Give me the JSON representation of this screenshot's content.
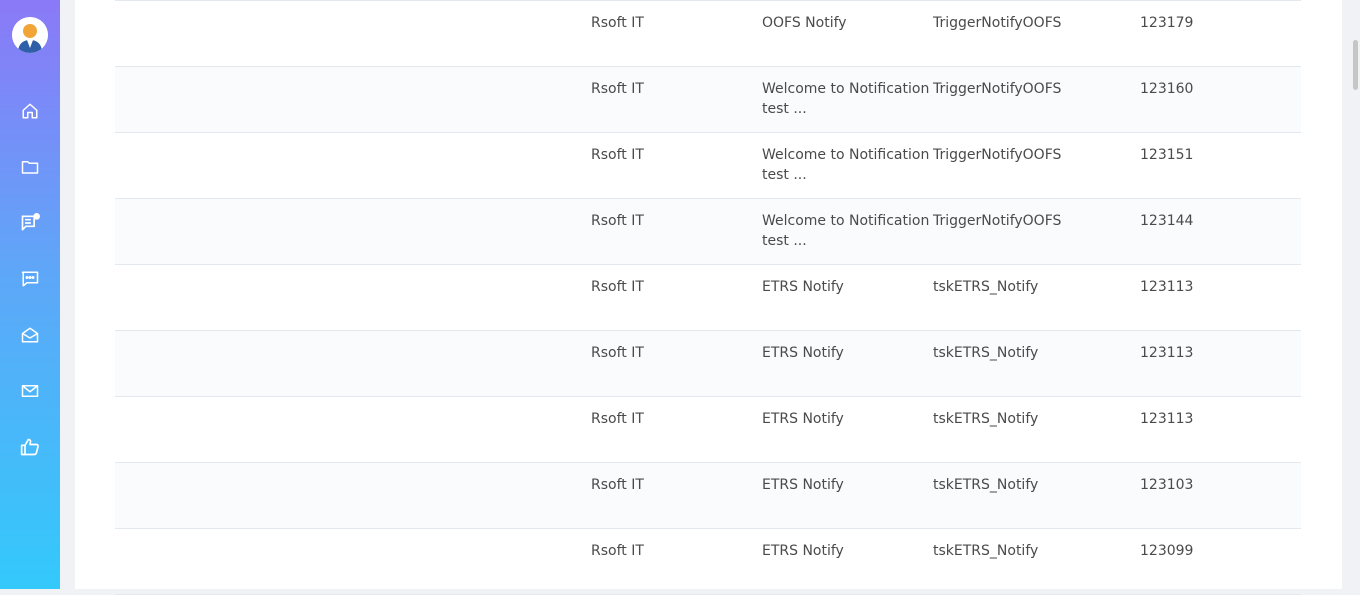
{
  "sidebar": {
    "gradient_top": "#8b79f7",
    "gradient_bottom": "#33c9fb",
    "avatar": "user-avatar",
    "items": [
      {
        "icon": "home-icon"
      },
      {
        "icon": "folder-icon"
      },
      {
        "icon": "notification-list-icon"
      },
      {
        "icon": "chat-icon"
      },
      {
        "icon": "mail-open-icon"
      },
      {
        "icon": "mail-icon"
      },
      {
        "icon": "thumbs-up-icon"
      }
    ]
  },
  "table": {
    "rows": [
      {
        "col1": "",
        "col2": "Rsoft IT",
        "col3": "OOFS Notify",
        "col4": "TriggerNotifyOOFS",
        "col5": "123179"
      },
      {
        "col1": "",
        "col2": "Rsoft IT",
        "col3": "Welcome to Notification test ...",
        "col4": "TriggerNotifyOOFS",
        "col5": "123160"
      },
      {
        "col1": "",
        "col2": "Rsoft IT",
        "col3": "Welcome to Notification test ...",
        "col4": "TriggerNotifyOOFS",
        "col5": "123151"
      },
      {
        "col1": "",
        "col2": "Rsoft IT",
        "col3": "Welcome to Notification test ...",
        "col4": "TriggerNotifyOOFS",
        "col5": "123144"
      },
      {
        "col1": "",
        "col2": "Rsoft IT",
        "col3": "ETRS Notify",
        "col4": "tskETRS_Notify",
        "col5": "123113"
      },
      {
        "col1": "",
        "col2": "Rsoft IT",
        "col3": "ETRS Notify",
        "col4": "tskETRS_Notify",
        "col5": "123113"
      },
      {
        "col1": "",
        "col2": "Rsoft IT",
        "col3": "ETRS Notify",
        "col4": "tskETRS_Notify",
        "col5": "123113"
      },
      {
        "col1": "",
        "col2": "Rsoft IT",
        "col3": "ETRS Notify",
        "col4": "tskETRS_Notify",
        "col5": "123103"
      },
      {
        "col1": "",
        "col2": "Rsoft IT",
        "col3": "ETRS Notify",
        "col4": "tskETRS_Notify",
        "col5": "123099"
      }
    ]
  }
}
